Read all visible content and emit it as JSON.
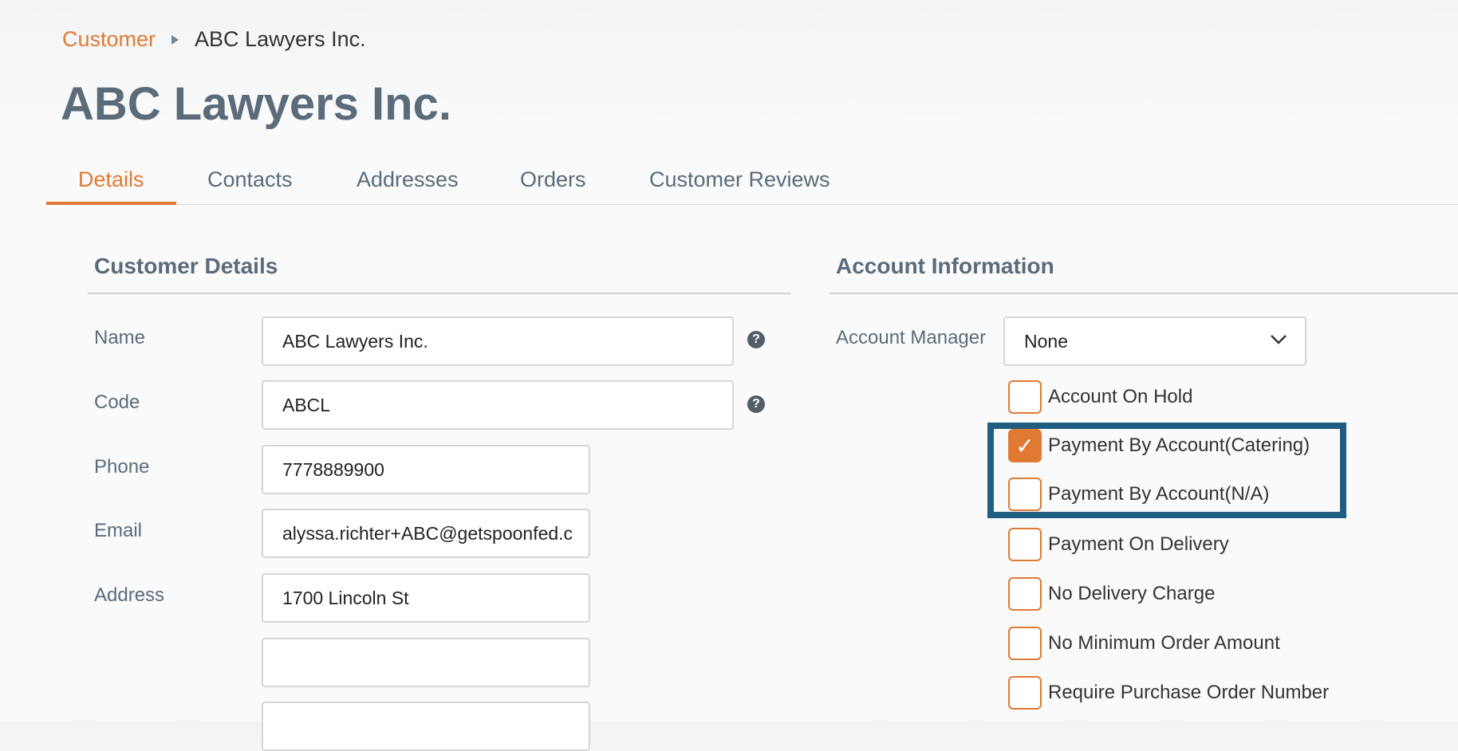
{
  "breadcrumb": {
    "parent": "Customer",
    "current": "ABC Lawyers Inc."
  },
  "page_title": "ABC Lawyers Inc.",
  "tabs": [
    {
      "label": "Details",
      "active": true
    },
    {
      "label": "Contacts",
      "active": false
    },
    {
      "label": "Addresses",
      "active": false
    },
    {
      "label": "Orders",
      "active": false
    },
    {
      "label": "Customer Reviews",
      "active": false
    }
  ],
  "customer_details": {
    "title": "Customer Details",
    "fields": {
      "name": {
        "label": "Name",
        "value": "ABC Lawyers Inc."
      },
      "code": {
        "label": "Code",
        "value": "ABCL"
      },
      "phone": {
        "label": "Phone",
        "value": "7778889900"
      },
      "email": {
        "label": "Email",
        "value": "alyssa.richter+ABC@getspoonfed.c"
      },
      "address": {
        "label": "Address",
        "line1": "1700 Lincoln St",
        "line2": "",
        "line3": ""
      }
    },
    "help_icon_glyph": "?"
  },
  "account_information": {
    "title": "Account Information",
    "account_manager": {
      "label": "Account Manager",
      "value": "None"
    },
    "checkboxes": [
      {
        "label": "Account On Hold",
        "checked": false
      },
      {
        "label": "Payment By Account(Catering)",
        "checked": true
      },
      {
        "label": "Payment By Account(N/A)",
        "checked": false
      },
      {
        "label": "Payment On Delivery",
        "checked": false
      },
      {
        "label": "No Delivery Charge",
        "checked": false
      },
      {
        "label": "No Minimum Order Amount",
        "checked": false
      },
      {
        "label": "Require Purchase Order Number",
        "checked": false
      }
    ],
    "check_glyph": "✓"
  },
  "colors": {
    "accent": "#e07a33",
    "heading": "#5b6b79",
    "highlight_border": "#1f5e80"
  }
}
